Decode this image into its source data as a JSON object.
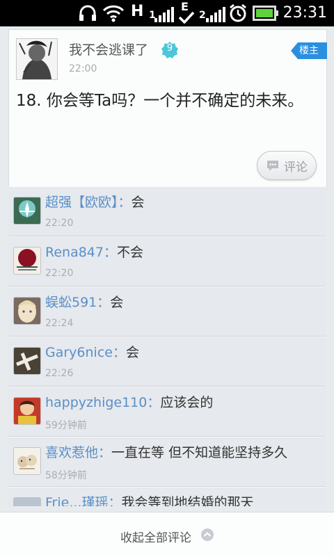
{
  "status_bar": {
    "time": "23:31",
    "network_h": "H",
    "network_e": "E",
    "sim1": "1",
    "sim2": "2",
    "icons": [
      "headset-icon",
      "wifi-icon",
      "signal-h-icon",
      "signal-e-icon",
      "alarm-icon",
      "battery-icon"
    ]
  },
  "post": {
    "username": "我不会逃课了",
    "level": "9",
    "time": "22:00",
    "owner_badge": "楼主",
    "text": "18. 你会等Ta吗？一个并不确定的未来。",
    "comment_button_label": "评论"
  },
  "comments": [
    {
      "name": "超强【欧欧】",
      "separator": "：",
      "text": "会",
      "time": "22:20"
    },
    {
      "name": "Rena847",
      "separator": "：",
      "text": "不会",
      "time": "22:20"
    },
    {
      "name": "蜈蚣591",
      "separator": "：",
      "text": "会",
      "time": "22:24"
    },
    {
      "name": "Gary6nice",
      "separator": "：",
      "text": "会",
      "time": "22:26"
    },
    {
      "name": "happyzhige110",
      "separator": "：",
      "text": "应该会的",
      "time": "59分钟前"
    },
    {
      "name": "喜欢惹他",
      "separator": "：",
      "text": "一直在等 但不知道能坚持多久",
      "time": "58分钟前"
    },
    {
      "name": "Frie...瑾瑶",
      "separator": "：",
      "text": "我会等到地结婚的那天",
      "time": ""
    }
  ],
  "bottom": {
    "collapse_label": "收起全部评论"
  },
  "colors": {
    "name_blue": "#5a8fc8",
    "owner_badge_blue": "#2b8fe0",
    "level_badge_teal": "#4fc6d8"
  }
}
